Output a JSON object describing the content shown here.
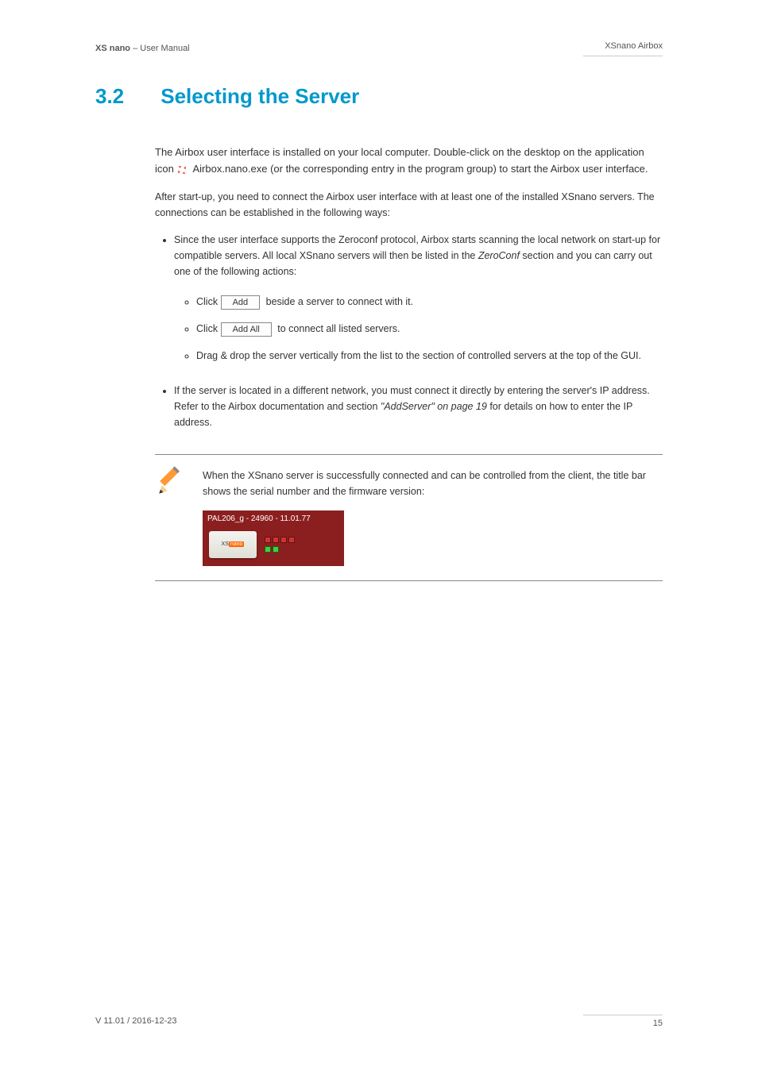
{
  "header": {
    "product": "XS nano",
    "doc": "User Manual",
    "section_label": "XSnano Airbox"
  },
  "heading": {
    "number": "3.2",
    "title": "Selecting the Server"
  },
  "intro": {
    "p1_a": "The Airbox user interface is installed on your local computer. Double-click on the desktop on the application icon",
    "airbox_exe": "Airbox.nano.exe",
    "p1_b": " (or the corresponding entry in the program group) to start the Airbox user interface.",
    "p2": "After start-up, you need to connect the Airbox user interface with at least one of the installed XSnano servers. The connections can be established in the following ways:"
  },
  "bullets": {
    "b1_a": "Since the user interface supports the Zeroconf protocol, Airbox starts scanning the local network on start-up for compatible servers. All local XSnano servers will then be listed in the ",
    "b1_b": " section and you can carry out one of the following actions:",
    "sub": {
      "s1_a": "Click ",
      "s1_btn": "Add",
      "s1_b": " beside a server to connect with it.",
      "s2_a": "Click ",
      "s2_btn": "Add All",
      "s2_b": " to connect all listed servers.",
      "s3": "Drag & drop the server vertically from the list to the section of controlled servers at the top of the GUI."
    },
    "b2_a": "If the server is located in a different network, you must connect it directly by entering the server's IP address. Refer to the Airbox documentation and section ",
    "b2_b": " for details on how to enter the IP address."
  },
  "zeroconf_label": "ZeroConf",
  "addserver_ref": "\"AddServer\" on page 19",
  "note": {
    "text": "When the XSnano server is successfully connected and can be controlled from the client, the title bar shows the serial number and the firmware version:",
    "titlebar": "PAL206_g - 24960 - 11.01.77",
    "brand_a": "XS",
    "brand_b": "nano"
  },
  "footer": {
    "version": "V 11.01 / 2016-12-23",
    "page": "15"
  }
}
